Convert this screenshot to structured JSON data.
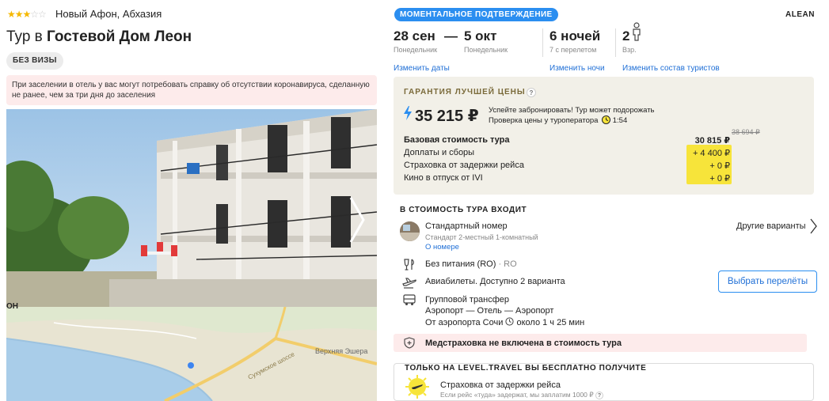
{
  "hotel": {
    "stars_on": "★★★",
    "stars_off": "☆☆",
    "location": "Новый Афон, Абхазия",
    "title_prefix": "Тур в",
    "title_name": "Гостевой Дом Леон",
    "visa_badge": "БЕЗ ВИЗЫ",
    "notice": "При заселении в отель у вас могут потребовать справку об отсутствии коронавируса, сделанную не ранее, чем за три дня до заселения"
  },
  "map": {
    "label_village": "Верхняя Эшера",
    "label_road": "Сухумское шоссе",
    "label_top": "ОН"
  },
  "tour": {
    "instant_badge": "МОМЕНТАЛЬНОЕ ПОДТВЕРЖДЕНИЕ",
    "operator": "ALEAN",
    "date_from": "28 сен",
    "date_dash": "—",
    "date_to": "5 окт",
    "day_from": "Понедельник",
    "day_to": "Понедельник",
    "nights": "6 ночей",
    "nights_sub": "7 с перелетом",
    "adults": "2",
    "adults_sub": "Взр.",
    "change_dates": "Изменить даты",
    "change_nights": "Изменить ночи",
    "change_tourists": "Изменить состав туристов"
  },
  "price": {
    "guarantee_title": "ГАРАНТИЯ ЛУЧШЕЙ ЦЕНЫ",
    "question": "?",
    "total": "35 215 ₽",
    "note_line1": "Успейте забронировать! Тур может подорожать",
    "note_line2": "Проверка цены у туроператора",
    "timer": "1:54",
    "old_price": "38 694 ₽",
    "rows": [
      {
        "label": "Базовая стоимость тура",
        "value": "30 815 ₽"
      },
      {
        "label": "Доплаты и сборы",
        "value": "+ 4 400 ₽"
      },
      {
        "label": "Страховка от задержки рейса",
        "value": "+ 0 ₽"
      },
      {
        "label": "Кино в отпуск от IVI",
        "value": "+ 0 ₽"
      }
    ]
  },
  "includes": {
    "title": "В СТОИМОСТЬ ТУРА ВХОДИТ",
    "room_name": "Стандартный номер",
    "room_sub": "Стандарт 2-местный 1-комнатный",
    "room_link": "О номере",
    "other_variants": "Другие варианты",
    "meal": "Без питания (RO)",
    "meal_code": "· RO",
    "flights": "Авиабилеты. Доступно 2 варианта",
    "choose_flights": "Выбрать перелёты",
    "transfer_title": "Групповой трансфер",
    "transfer_route": "Аэропорт — Отель — Аэропорт",
    "transfer_from": "От аэропорта Сочи",
    "transfer_time": "около 1 ч 25 мин",
    "med_insurance": "Медстраховка не включена в стоимость тура"
  },
  "free": {
    "title": "ТОЛЬКО НА LEVEL.TRAVEL ВЫ БЕСПЛАТНО ПОЛУЧИТЕ",
    "item_title": "Страховка от задержки рейса",
    "item_sub": "Если рейс «туда» задержат, мы заплатим 1000 ₽"
  },
  "colors": {
    "accent": "#2b8ef0",
    "link": "#1f6fd6",
    "highlight": "#f7e43a",
    "notice_bg": "#fdebeb",
    "guarantee_bg": "#f2f0e8"
  }
}
